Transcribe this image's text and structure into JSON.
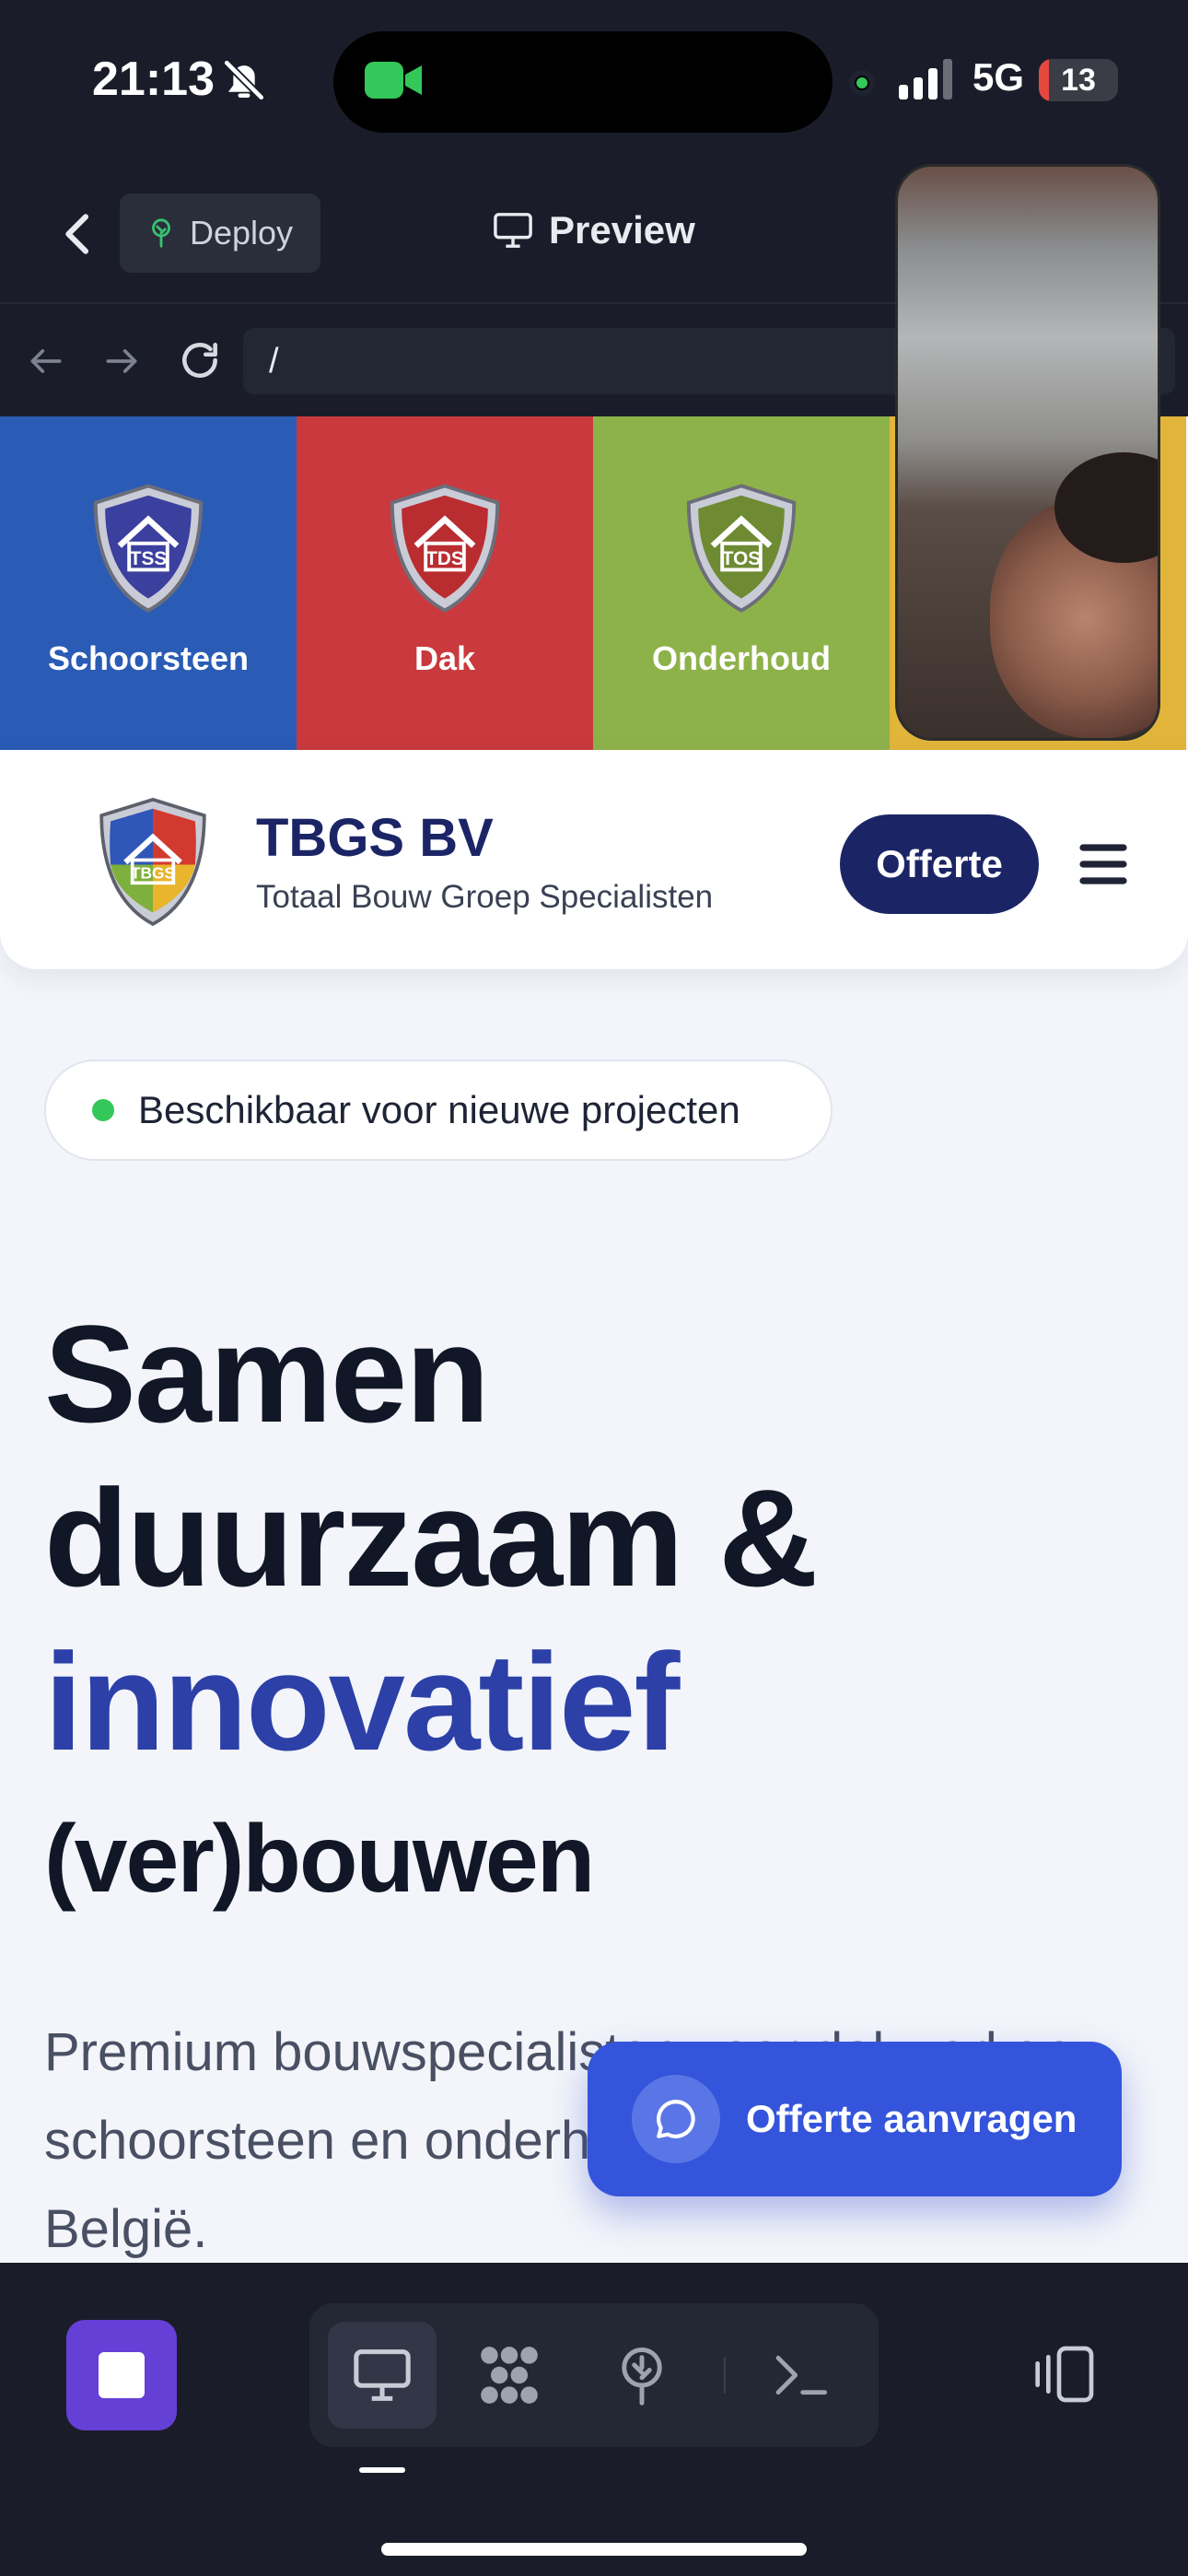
{
  "status_bar": {
    "time": "21:13",
    "network": "5G",
    "battery_label": "13",
    "battery_level": 0.13,
    "icons": [
      "bell-slash-icon",
      "facetime-camera-icon",
      "microphone-indicator-dot",
      "cellular-signal-icon",
      "battery-icon"
    ]
  },
  "app_header": {
    "deploy_label": "Deploy",
    "preview_label": "Preview"
  },
  "browser": {
    "url": "/"
  },
  "website": {
    "services": [
      {
        "label": "Schoorsteen",
        "color": "#2a5bb5"
      },
      {
        "label": "Dak",
        "color": "#c9393d"
      },
      {
        "label": "Onderhoud",
        "color": "#8eb24a"
      },
      {
        "label": "",
        "color": "#e1b53a"
      }
    ],
    "brand": {
      "name": "TBGS BV",
      "tagline": "Totaal Bouw Groep Specialisten",
      "logo_text": "TBGS"
    },
    "offerte_button": "Offerte",
    "availability": "Beschikbaar voor nieuwe projecten",
    "hero": {
      "line1": "Samen",
      "line2": "duurzaam &",
      "line3": "innovatief",
      "line4": "(ver)bouwen"
    },
    "hero_body": "Premium bouwspecialisten voor dakwerken, schoorsteen en onderhoud in Nederland en België.",
    "quote_fab": "Offerte aanvragen"
  },
  "colors": {
    "brand_navy": "#1b2566",
    "accent_blue": "#3455db",
    "hero_accent": "#2c40a8",
    "stop_purple": "#6540d6"
  },
  "toolbar": {
    "items": [
      "preview-monitor-icon",
      "components-grid-icon",
      "deploy-tree-icon",
      "terminal-icon"
    ],
    "right_icon": "device-switch-icon"
  }
}
